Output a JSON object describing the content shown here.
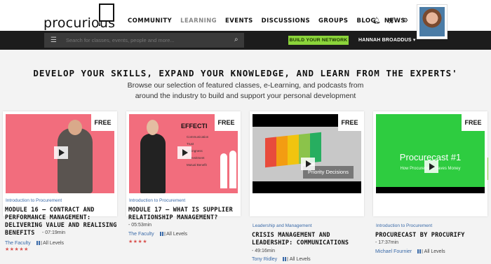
{
  "brand": {
    "logo_text": "procurious"
  },
  "nav": [
    {
      "label": "COMMUNITY"
    },
    {
      "label": "LEARNING"
    },
    {
      "label": "EVENTS"
    },
    {
      "label": "DISCUSSIONS"
    },
    {
      "label": "GROUPS"
    },
    {
      "label": "BLOG"
    },
    {
      "label": "NEWS"
    }
  ],
  "icons": {
    "notification": "bell-icon",
    "cart": "cart-icon",
    "settings": "gear-icon"
  },
  "search": {
    "placeholder": "Search for classes, events, people and more..."
  },
  "header_actions": {
    "build_network": "BUILD YOUR NETWORK",
    "user_name": "HANNAH BROADDUS ▾"
  },
  "hero": {
    "headline": "DEVELOP YOUR SKILLS, EXPAND YOUR KNOWLEDGE, AND LEARN FROM THE EXPERTS'",
    "subtitle": "Browse our selection of featured classes, e-Learning, and podcasts from around the industry to build and support your personal development"
  },
  "cards": [
    {
      "badge": "FREE",
      "category": "Introduction to Procurement",
      "title": "MODULE 16 – CONTRACT AND PERFORMANCE MANAGEMENT: DELIVERING VALUE AND REALISING BENEFITS",
      "duration": "- 07:19min",
      "author": "The Faculty",
      "level": "All Levels",
      "stars": "★★★★★",
      "rating": 5
    },
    {
      "badge": "FREE",
      "category": "Introduction to Procurement",
      "title": "MODULE 17 – WHAT IS SUPPLIER RELATIONSHIP MANAGEMENT?",
      "duration": "- 05:53min",
      "author": "The Faculty",
      "level": "All Levels",
      "stars": "★★★★",
      "rating": 4,
      "slide_title": "EFFECTI",
      "slide_items": [
        "Communication",
        "Trust",
        "Willingness",
        "Commitment",
        "Mutual Benefit"
      ]
    },
    {
      "badge": "FREE",
      "category": "Leadership and Management",
      "title": "CRISIS MANAGEMENT AND LEADERSHIP: COMMUNICATIONS",
      "duration": "- 49:16min",
      "author": "Tony Ridley",
      "level": "All Levels",
      "slide_caption": "Priority Decisions"
    },
    {
      "badge": "FREE",
      "category": "Introduction to Procurement",
      "title": "PROCURECAST BY PROCURIFY",
      "duration": "- 17:37min",
      "author": "Michael Fournier",
      "level": "All Levels",
      "slide_title": "Procurecast #1",
      "slide_sub": "How Procurement Saves Money"
    }
  ],
  "carousel": {
    "prev": "‹",
    "next": "›"
  }
}
